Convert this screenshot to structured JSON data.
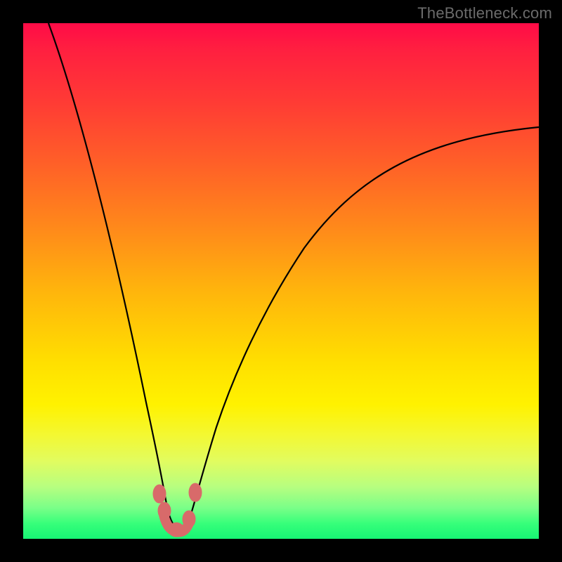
{
  "watermark": "TheBottleneck.com",
  "colors": {
    "frame": "#000000",
    "gradient_top": "#ff0b47",
    "gradient_bottom": "#17f474",
    "curve": "#000000",
    "marker": "#d86a6a"
  },
  "chart_data": {
    "type": "line",
    "title": "",
    "xlabel": "",
    "ylabel": "",
    "xlim": [
      0,
      100
    ],
    "ylim": [
      0,
      100
    ],
    "grid": false,
    "legend": false,
    "note": "Axes unlabeled; values are approximate readings from pixel positions. y=0 at bottom (green), y=100 at top (red). Single black curve with a sharp minimum near x≈28 and a shallower rise to the right.",
    "x": [
      0,
      2,
      4,
      6,
      8,
      10,
      12,
      14,
      16,
      18,
      20,
      22,
      24,
      26,
      27,
      28,
      29,
      30,
      31,
      33,
      36,
      40,
      45,
      50,
      55,
      60,
      65,
      70,
      75,
      80,
      85,
      90,
      95,
      100
    ],
    "y": [
      100,
      93,
      86,
      79,
      72,
      65,
      58,
      51,
      44,
      37,
      30,
      22,
      15,
      8,
      5,
      3,
      3,
      4,
      5,
      8,
      13,
      20,
      28,
      35,
      41,
      47,
      52,
      57,
      61,
      65,
      69,
      73,
      76,
      79
    ],
    "markers": {
      "note": "Salmon rounded markers near the curve's minimum region.",
      "points_x": [
        24.5,
        26.5,
        28.0,
        30.0,
        31.5
      ],
      "points_y": [
        8.5,
        5.0,
        3.0,
        3.5,
        8.5
      ]
    }
  }
}
